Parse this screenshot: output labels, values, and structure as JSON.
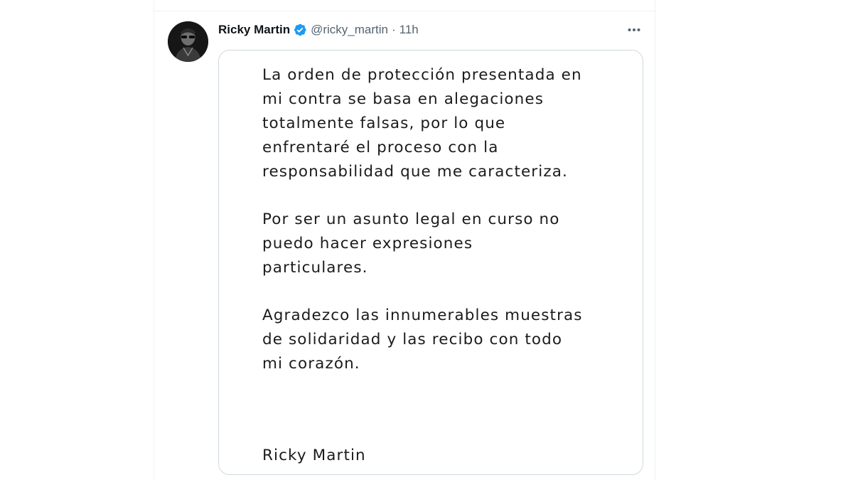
{
  "tweet": {
    "display_name": "Ricky Martin",
    "verified": true,
    "verified_color": "#1d9bf0",
    "handle": "@ricky_martin",
    "separator": "·",
    "time": "11h",
    "more_icon": "more-horizontal-icon"
  },
  "media": {
    "paragraphs": [
      "La orden de protección presentada en\nmi contra se basa en alegaciones\ntotalmente falsas, por lo que\nenfrentaré el proceso con la\nresponsabilidad que me caracteriza.",
      "Por ser un asunto legal en curso no\npuedo hacer expresiones\nparticulares.",
      "Agradezco las innumerables muestras\nde solidaridad y las recibo con todo\nmi corazón."
    ],
    "signature": "Ricky Martin"
  }
}
